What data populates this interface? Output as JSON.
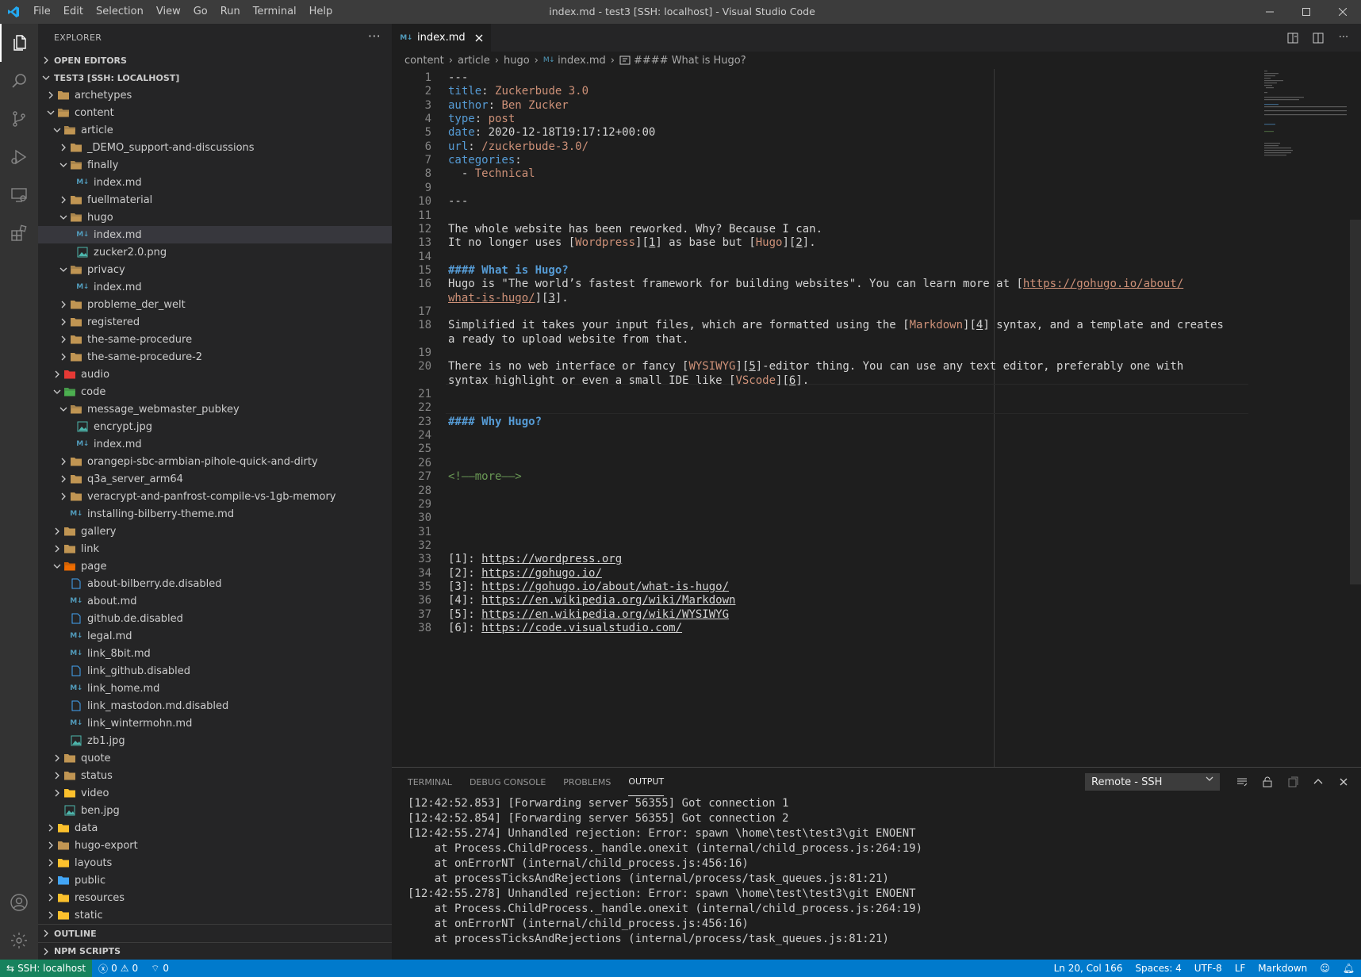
{
  "window": {
    "title": "index.md - test3 [SSH: localhost] - Visual Studio Code",
    "menu": [
      "File",
      "Edit",
      "Selection",
      "View",
      "Go",
      "Run",
      "Terminal",
      "Help"
    ]
  },
  "sidebar": {
    "header": "EXPLORER",
    "open_editors": "OPEN EDITORS",
    "workspace": "TEST3 [SSH: LOCALHOST]",
    "outline": "OUTLINE",
    "npm_scripts": "NPM SCRIPTS",
    "tree": [
      {
        "label": "archetypes",
        "type": "folder",
        "level": 1,
        "open": false
      },
      {
        "label": "content",
        "type": "folder",
        "level": 1,
        "open": true
      },
      {
        "label": "article",
        "type": "folder",
        "level": 2,
        "open": true
      },
      {
        "label": "_DEMO_support-and-discussions",
        "type": "folder",
        "level": 3,
        "open": false
      },
      {
        "label": "finally",
        "type": "folder",
        "level": 3,
        "open": true
      },
      {
        "label": "index.md",
        "type": "md",
        "level": 4
      },
      {
        "label": "fuellmaterial",
        "type": "folder",
        "level": 3,
        "open": false
      },
      {
        "label": "hugo",
        "type": "folder",
        "level": 3,
        "open": true
      },
      {
        "label": "index.md",
        "type": "md",
        "level": 4,
        "selected": true
      },
      {
        "label": "zucker2.0.png",
        "type": "img",
        "level": 4
      },
      {
        "label": "privacy",
        "type": "folder",
        "level": 3,
        "open": true
      },
      {
        "label": "index.md",
        "type": "md",
        "level": 4
      },
      {
        "label": "probleme_der_welt",
        "type": "folder",
        "level": 3,
        "open": false
      },
      {
        "label": "registered",
        "type": "folder",
        "level": 3,
        "open": false
      },
      {
        "label": "the-same-procedure",
        "type": "folder",
        "level": 3,
        "open": false
      },
      {
        "label": "the-same-procedure-2",
        "type": "folder",
        "level": 3,
        "open": false
      },
      {
        "label": "audio",
        "type": "folder-audio",
        "level": 2,
        "open": false
      },
      {
        "label": "code",
        "type": "folder-code",
        "level": 2,
        "open": true
      },
      {
        "label": "message_webmaster_pubkey",
        "type": "folder",
        "level": 3,
        "open": true
      },
      {
        "label": "encrypt.jpg",
        "type": "img",
        "level": 4
      },
      {
        "label": "index.md",
        "type": "md",
        "level": 4
      },
      {
        "label": "orangepi-sbc-armbian-pihole-quick-and-dirty",
        "type": "folder",
        "level": 3,
        "open": false
      },
      {
        "label": "q3a_server_arm64",
        "type": "folder",
        "level": 3,
        "open": false
      },
      {
        "label": "veracrypt-and-panfrost-compile-vs-1gb-memory",
        "type": "folder",
        "level": 3,
        "open": false
      },
      {
        "label": "installing-bilberry-theme.md",
        "type": "md",
        "level": 3
      },
      {
        "label": "gallery",
        "type": "folder",
        "level": 2,
        "open": false
      },
      {
        "label": "link",
        "type": "folder",
        "level": 2,
        "open": false
      },
      {
        "label": "page",
        "type": "folder-page",
        "level": 2,
        "open": true
      },
      {
        "label": "about-bilberry.de.disabled",
        "type": "file",
        "level": 3
      },
      {
        "label": "about.md",
        "type": "md",
        "level": 3
      },
      {
        "label": "github.de.disabled",
        "type": "file",
        "level": 3
      },
      {
        "label": "legal.md",
        "type": "md",
        "level": 3
      },
      {
        "label": "link_8bit.md",
        "type": "md",
        "level": 3
      },
      {
        "label": "link_github.disabled",
        "type": "file",
        "level": 3
      },
      {
        "label": "link_home.md",
        "type": "md",
        "level": 3
      },
      {
        "label": "link_mastodon.md.disabled",
        "type": "file",
        "level": 3
      },
      {
        "label": "link_wintermohn.md",
        "type": "md",
        "level": 3
      },
      {
        "label": "zb1.jpg",
        "type": "img",
        "level": 3
      },
      {
        "label": "quote",
        "type": "folder",
        "level": 2,
        "open": false
      },
      {
        "label": "status",
        "type": "folder",
        "level": 2,
        "open": false
      },
      {
        "label": "video",
        "type": "folder-video",
        "level": 2,
        "open": false
      },
      {
        "label": "ben.jpg",
        "type": "img",
        "level": 2
      },
      {
        "label": "data",
        "type": "folder-yellow",
        "level": 1,
        "open": false
      },
      {
        "label": "hugo-export",
        "type": "folder",
        "level": 1,
        "open": false
      },
      {
        "label": "layouts",
        "type": "folder-yellow",
        "level": 1,
        "open": false
      },
      {
        "label": "public",
        "type": "folder-public",
        "level": 1,
        "open": false
      },
      {
        "label": "resources",
        "type": "folder-yellow",
        "level": 1,
        "open": false
      },
      {
        "label": "static",
        "type": "folder-yellow",
        "level": 1,
        "open": false
      }
    ]
  },
  "editor": {
    "tab_label": "index.md",
    "tab_icon": "M↓",
    "breadcrumbs": [
      "content",
      "article",
      "hugo",
      "index.md",
      "#### What is Hugo?"
    ],
    "lines": [
      {
        "n": "1",
        "html": "<span class='t'>---</span>"
      },
      {
        "n": "2",
        "html": "<span class='k'>title</span><span class='t'>: </span><span class='s'>Zuckerbude 3.0</span>"
      },
      {
        "n": "3",
        "html": "<span class='k'>author</span><span class='t'>: </span><span class='s'>Ben Zucker</span>"
      },
      {
        "n": "4",
        "html": "<span class='k'>type</span><span class='t'>: </span><span class='s'>post</span>"
      },
      {
        "n": "5",
        "html": "<span class='k'>date</span><span class='t'>: </span><span class='t'>2020-12-18T19:17:12+00:00</span>"
      },
      {
        "n": "6",
        "html": "<span class='k'>url</span><span class='t'>: </span><span class='s'>/zuckerbude-3.0/</span>"
      },
      {
        "n": "7",
        "html": "<span class='k'>categories</span><span class='t'>:</span>"
      },
      {
        "n": "8",
        "html": "<span class='t'>  - </span><span class='s'>Technical</span>"
      },
      {
        "n": "9",
        "html": ""
      },
      {
        "n": "10",
        "html": "<span class='t'>---</span>"
      },
      {
        "n": "11",
        "html": ""
      },
      {
        "n": "12",
        "html": "<span class='t'>The whole website has been reworked. Why? Because I can.</span>"
      },
      {
        "n": "13",
        "html": "<span class='t'>It no longer uses [</span><span class='s'>Wordpress</span><span class='t'>][</span><span class='u'>1</span><span class='t'>] as base but [</span><span class='s'>Hugo</span><span class='t'>][</span><span class='u'>2</span><span class='t'>].</span>"
      },
      {
        "n": "14",
        "html": ""
      },
      {
        "n": "15",
        "html": "<span class='h'>#### What is Hugo?</span>"
      },
      {
        "n": "16",
        "html": "<span class='t'>Hugo is \"The world’s fastest framework for building websites\". You can learn more at [</span><span class='lnk'>https://gohugo.io/about/</span>"
      },
      {
        "n": "",
        "html": "<span class='lnk'>what-is-hugo/</span><span class='t'>][</span><span class='u'>3</span><span class='t'>].</span>"
      },
      {
        "n": "17",
        "html": ""
      },
      {
        "n": "18",
        "html": "<span class='t'>Simplified it takes your input files, which are formatted using the [</span><span class='s'>Markdown</span><span class='t'>][</span><span class='u'>4</span><span class='t'>] syntax, and a template and creates</span>"
      },
      {
        "n": "",
        "html": "<span class='t'>a ready to upload website from that.</span>"
      },
      {
        "n": "19",
        "html": ""
      },
      {
        "n": "20",
        "html": "<span class='t'>There is no web interface or fancy [</span><span class='s'>WYSIWYG</span><span class='t'>][</span><span class='u'>5</span><span class='t'>]-editor thing. You can use any text editor, preferably one with</span>"
      },
      {
        "n": "",
        "html": "<span class='t'>syntax highlight or even a small IDE like [</span><span class='s'>VScode</span><span class='t'>][</span><span class='u'>6</span><span class='t'>].</span>"
      },
      {
        "n": "21",
        "html": ""
      },
      {
        "n": "22",
        "html": ""
      },
      {
        "n": "23",
        "html": "<span class='h'>#### Why Hugo?</span>"
      },
      {
        "n": "24",
        "html": ""
      },
      {
        "n": "25",
        "html": ""
      },
      {
        "n": "26",
        "html": ""
      },
      {
        "n": "27",
        "html": "<span class='cm'>&lt;!——more——&gt;</span>"
      },
      {
        "n": "28",
        "html": ""
      },
      {
        "n": "29",
        "html": ""
      },
      {
        "n": "30",
        "html": ""
      },
      {
        "n": "31",
        "html": ""
      },
      {
        "n": "32",
        "html": ""
      },
      {
        "n": "33",
        "html": "<span class='t'>[1]: </span><span class='t u'>https://wordpress.org</span>"
      },
      {
        "n": "34",
        "html": "<span class='t'>[2]: </span><span class='t u'>https://gohugo.io/</span>"
      },
      {
        "n": "35",
        "html": "<span class='t'>[3]: </span><span class='t u'>https://gohugo.io/about/what-is-hugo/</span>"
      },
      {
        "n": "36",
        "html": "<span class='t'>[4]: </span><span class='t u'>https://en.wikipedia.org/wiki/Markdown</span>"
      },
      {
        "n": "37",
        "html": "<span class='t'>[5]: </span><span class='t u'>https://en.wikipedia.org/wiki/WYSIWYG</span>"
      },
      {
        "n": "38",
        "html": "<span class='t'>[6]: </span><span class='t u'>https://code.visualstudio.com/</span>"
      }
    ]
  },
  "panel": {
    "tabs": [
      "TERMINAL",
      "DEBUG CONSOLE",
      "PROBLEMS",
      "OUTPUT"
    ],
    "active_tab": "OUTPUT",
    "channel": "Remote - SSH",
    "output": [
      "[12:42:52.853] [Forwarding server 56355] Got connection 1",
      "[12:42:52.854] [Forwarding server 56355] Got connection 2",
      "[12:42:55.274] Unhandled rejection: Error: spawn \\home\\test\\test3\\git ENOENT",
      "    at Process.ChildProcess._handle.onexit (internal/child_process.js:264:19)",
      "    at onErrorNT (internal/child_process.js:456:16)",
      "    at processTicksAndRejections (internal/process/task_queues.js:81:21)",
      "[12:42:55.278] Unhandled rejection: Error: spawn \\home\\test\\test3\\git ENOENT",
      "    at Process.ChildProcess._handle.onexit (internal/child_process.js:264:19)",
      "    at onErrorNT (internal/child_process.js:456:16)",
      "    at processTicksAndRejections (internal/process/task_queues.js:81:21)"
    ]
  },
  "statusbar": {
    "remote": "SSH: localhost",
    "errors": "0",
    "warnings": "0",
    "ports": "0",
    "position": "Ln 20, Col 166",
    "spaces": "Spaces: 4",
    "encoding": "UTF-8",
    "eol": "LF",
    "language": "Markdown"
  },
  "colors": {
    "accent": "#007acc",
    "remote": "#16825d",
    "folder": "#c09553",
    "md": "#519aba"
  }
}
